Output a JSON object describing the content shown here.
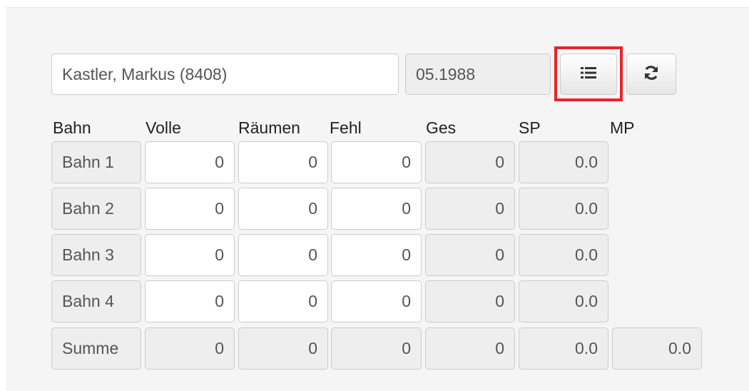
{
  "player": {
    "name_value": "Kastler, Markus (8408)",
    "date_value": "05.1988",
    "list_icon": "list-icon",
    "refresh_icon": "refresh-icon"
  },
  "columns": [
    "Bahn",
    "Volle",
    "Räumen",
    "Fehl",
    "Ges",
    "SP",
    "MP"
  ],
  "rows": [
    {
      "label": "Bahn 1",
      "volle": "0",
      "raeumen": "0",
      "fehl": "0",
      "ges": "0",
      "sp": "0.0"
    },
    {
      "label": "Bahn 2",
      "volle": "0",
      "raeumen": "0",
      "fehl": "0",
      "ges": "0",
      "sp": "0.0"
    },
    {
      "label": "Bahn 3",
      "volle": "0",
      "raeumen": "0",
      "fehl": "0",
      "ges": "0",
      "sp": "0.0"
    },
    {
      "label": "Bahn 4",
      "volle": "0",
      "raeumen": "0",
      "fehl": "0",
      "ges": "0",
      "sp": "0.0"
    }
  ],
  "sum": {
    "label": "Summe",
    "volle": "0",
    "raeumen": "0",
    "fehl": "0",
    "ges": "0",
    "sp": "0.0",
    "mp": "0.0"
  },
  "colors": {
    "highlight": "#e8242b",
    "readonly_bg": "#eeeeee"
  }
}
